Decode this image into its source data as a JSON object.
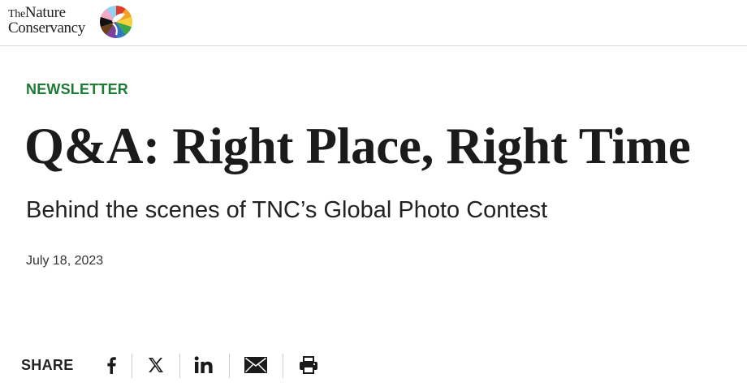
{
  "header": {
    "logo": {
      "line1_prefix": "The",
      "line1_word": "Nature",
      "line2": "Conservancy",
      "mark_colors": [
        "#e03b2b",
        "#f4a223",
        "#f5d23a",
        "#3aa64a",
        "#2f78c4",
        "#7b3fa0",
        "#6a3f1f",
        "#111111",
        "#f4a8c8",
        "#8fd3f0"
      ]
    }
  },
  "article": {
    "eyebrow": "NEWSLETTER",
    "title": "Q&A: Right Place, Right Time",
    "subtitle": "Behind the scenes of TNC’s Global Photo Contest",
    "date": "July 18, 2023"
  },
  "share": {
    "label": "SHARE",
    "buttons": [
      {
        "icon": "facebook-icon"
      },
      {
        "icon": "x-icon"
      },
      {
        "icon": "linkedin-icon"
      },
      {
        "icon": "email-icon"
      },
      {
        "icon": "print-icon"
      }
    ]
  }
}
